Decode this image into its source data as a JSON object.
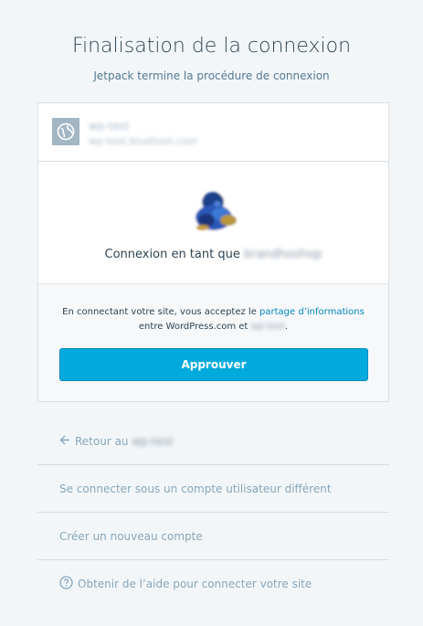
{
  "header": {
    "title": "Finalisation de la connexion",
    "subtitle": "Jetpack termine la procédure de connexion"
  },
  "site": {
    "name": "wp-test",
    "url": "wp-test.bluehost.com",
    "icon": "globe-icon"
  },
  "user": {
    "logged_in_prefix": "Connexion en tant que",
    "username": "brandhoshop"
  },
  "terms": {
    "prefix": "En connectant votre site, vous acceptez le",
    "link": "partage d’informations",
    "middle": "entre WordPress.com et",
    "site": "wp-test",
    "suffix": "."
  },
  "actions": {
    "approve_label": "Approuver"
  },
  "links": {
    "back_prefix": "Retour au",
    "back_site": "wp-test",
    "other_account": "Se connecter sous un compte utilisateur différent",
    "new_account": "Créer un nouveau compte",
    "help": "Obtenir de l’aide pour connecter votre site"
  },
  "colors": {
    "background": "#f3f6f8",
    "button": "#00aadc",
    "link": "#0087be",
    "muted_link": "#87a6bc"
  }
}
